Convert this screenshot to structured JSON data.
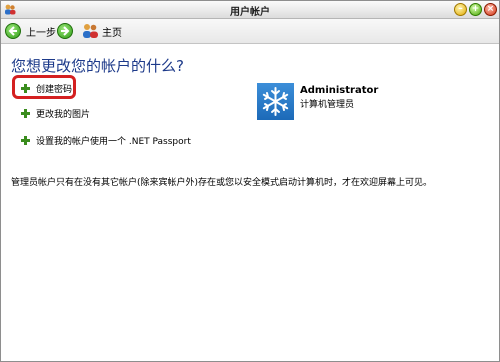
{
  "window": {
    "title": "用户帐户"
  },
  "toolbar": {
    "back_label": "上一步",
    "home_label": "主页"
  },
  "main": {
    "heading": "您想更改您的帐户的什么?",
    "tasks": [
      {
        "label": "创建密码"
      },
      {
        "label": "更改我的图片"
      },
      {
        "label": "设置我的帐户使用一个 .NET Passport"
      }
    ],
    "note": "管理员帐户只有在没有其它帐户(除来宾帐户外)存在或您以安全模式启动计算机时，才在欢迎屏幕上可见。"
  },
  "account": {
    "name": "Administrator",
    "role": "计算机管理员"
  },
  "colors": {
    "heading": "#1d3a8a",
    "highlight": "#d42020",
    "accent": "#3a8c1d"
  }
}
